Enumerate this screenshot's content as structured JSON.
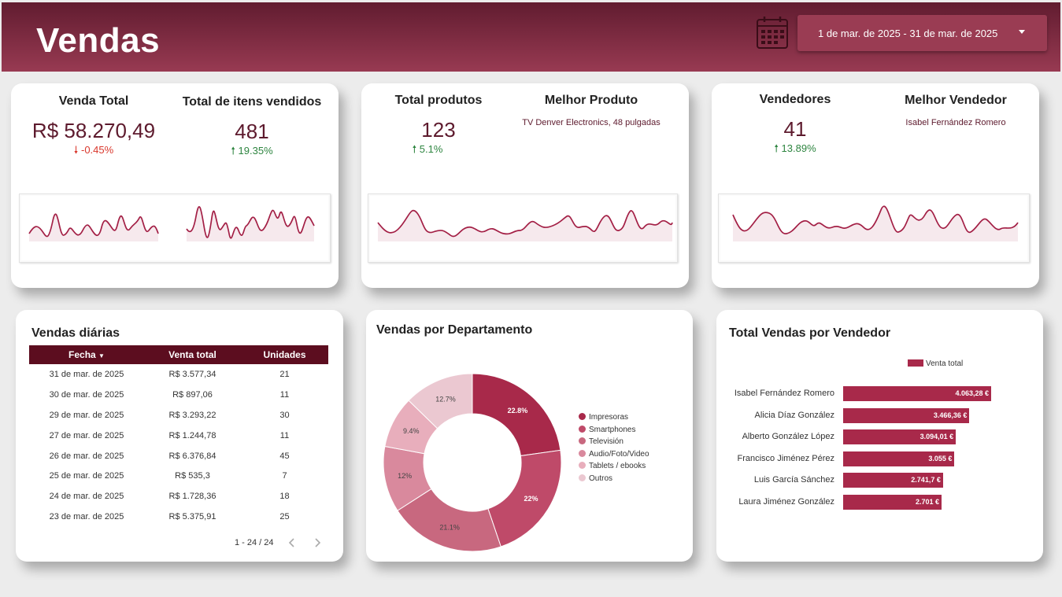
{
  "header": {
    "title": "Vendas",
    "date_range": "1 de mar. de 2025 - 31 de mar. de 2025",
    "calendar_icon": "calendar-icon"
  },
  "kpis": {
    "venda_total": {
      "label": "Venda Total",
      "value": "R$ 58.270,49",
      "delta": "-0.45%",
      "direction": "down"
    },
    "itens_vendidos": {
      "label": "Total de itens vendidos",
      "value": "481",
      "delta": "19.35%",
      "direction": "up"
    },
    "total_produtos": {
      "label": "Total produtos",
      "value": "123",
      "delta": "5.1%",
      "direction": "up"
    },
    "melhor_produto": {
      "label": "Melhor Produto",
      "value": "TV Denver Electronics, 48 pulgadas"
    },
    "vendedores": {
      "label": "Vendedores",
      "value": "41",
      "delta": "13.89%",
      "direction": "up"
    },
    "melhor_vendedor": {
      "label": "Melhor Vendedor",
      "value": "Isabel Fernández Romero"
    }
  },
  "daily_sales": {
    "title": "Vendas diárias",
    "columns": [
      "Fecha",
      "Venta total",
      "Unidades"
    ],
    "rows": [
      [
        "31 de mar. de 2025",
        "R$ 3.577,34",
        "21"
      ],
      [
        "30 de mar. de 2025",
        "R$ 897,06",
        "11"
      ],
      [
        "29 de mar. de 2025",
        "R$ 3.293,22",
        "30"
      ],
      [
        "27 de mar. de 2025",
        "R$ 1.244,78",
        "11"
      ],
      [
        "26 de mar. de 2025",
        "R$ 6.376,84",
        "45"
      ],
      [
        "25 de mar. de 2025",
        "R$ 535,3",
        "7"
      ],
      [
        "24 de mar. de 2025",
        "R$ 1.728,36",
        "18"
      ],
      [
        "23 de mar. de 2025",
        "R$ 5.375,91",
        "25"
      ]
    ],
    "pagination": "1 - 24 / 24"
  },
  "department": {
    "title": "Vendas por Departamento",
    "legend": [
      "Impresoras",
      "Smartphones",
      "Televisión",
      "Audio/Foto/Video",
      "Tablets / ebooks",
      "Outros"
    ],
    "colors": [
      "#a8294a",
      "#bf4a69",
      "#c8687f",
      "#d9899d",
      "#e8aebc",
      "#ebc8d1"
    ],
    "labels": [
      "22.8%",
      "22%",
      "21.1%",
      "12%",
      "9.4%",
      "12.7%"
    ]
  },
  "sellers": {
    "title": "Total Vendas por Vendedor",
    "legend": "Venta total",
    "names": [
      "Isabel Fernández Romero",
      "Alicia Díaz González",
      "Alberto González López",
      "Francisco Jiménez Pérez",
      "Luis García Sánchez",
      "Laura Jiménez González"
    ],
    "labels": [
      "4.063,28 €",
      "3.466,36 €",
      "3.094,01 €",
      "3.055 €",
      "2.741,7 €",
      "2.701 €"
    ]
  },
  "chart_data": [
    {
      "type": "pie",
      "title": "Vendas por Departamento",
      "categories": [
        "Impresoras",
        "Smartphones",
        "Televisión",
        "Audio/Foto/Video",
        "Tablets / ebooks",
        "Outros"
      ],
      "values": [
        22.8,
        22,
        21.1,
        12,
        9.4,
        12.7
      ]
    },
    {
      "type": "bar",
      "title": "Total Vendas por Vendedor",
      "categories": [
        "Isabel Fernández Romero",
        "Alicia Díaz González",
        "Alberto González López",
        "Francisco Jiménez Pérez",
        "Luis García Sánchez",
        "Laura Jiménez González"
      ],
      "series": [
        {
          "name": "Venta total",
          "values": [
            4063.28,
            3466.36,
            3094.01,
            3055,
            2741.7,
            2701
          ]
        }
      ]
    }
  ]
}
